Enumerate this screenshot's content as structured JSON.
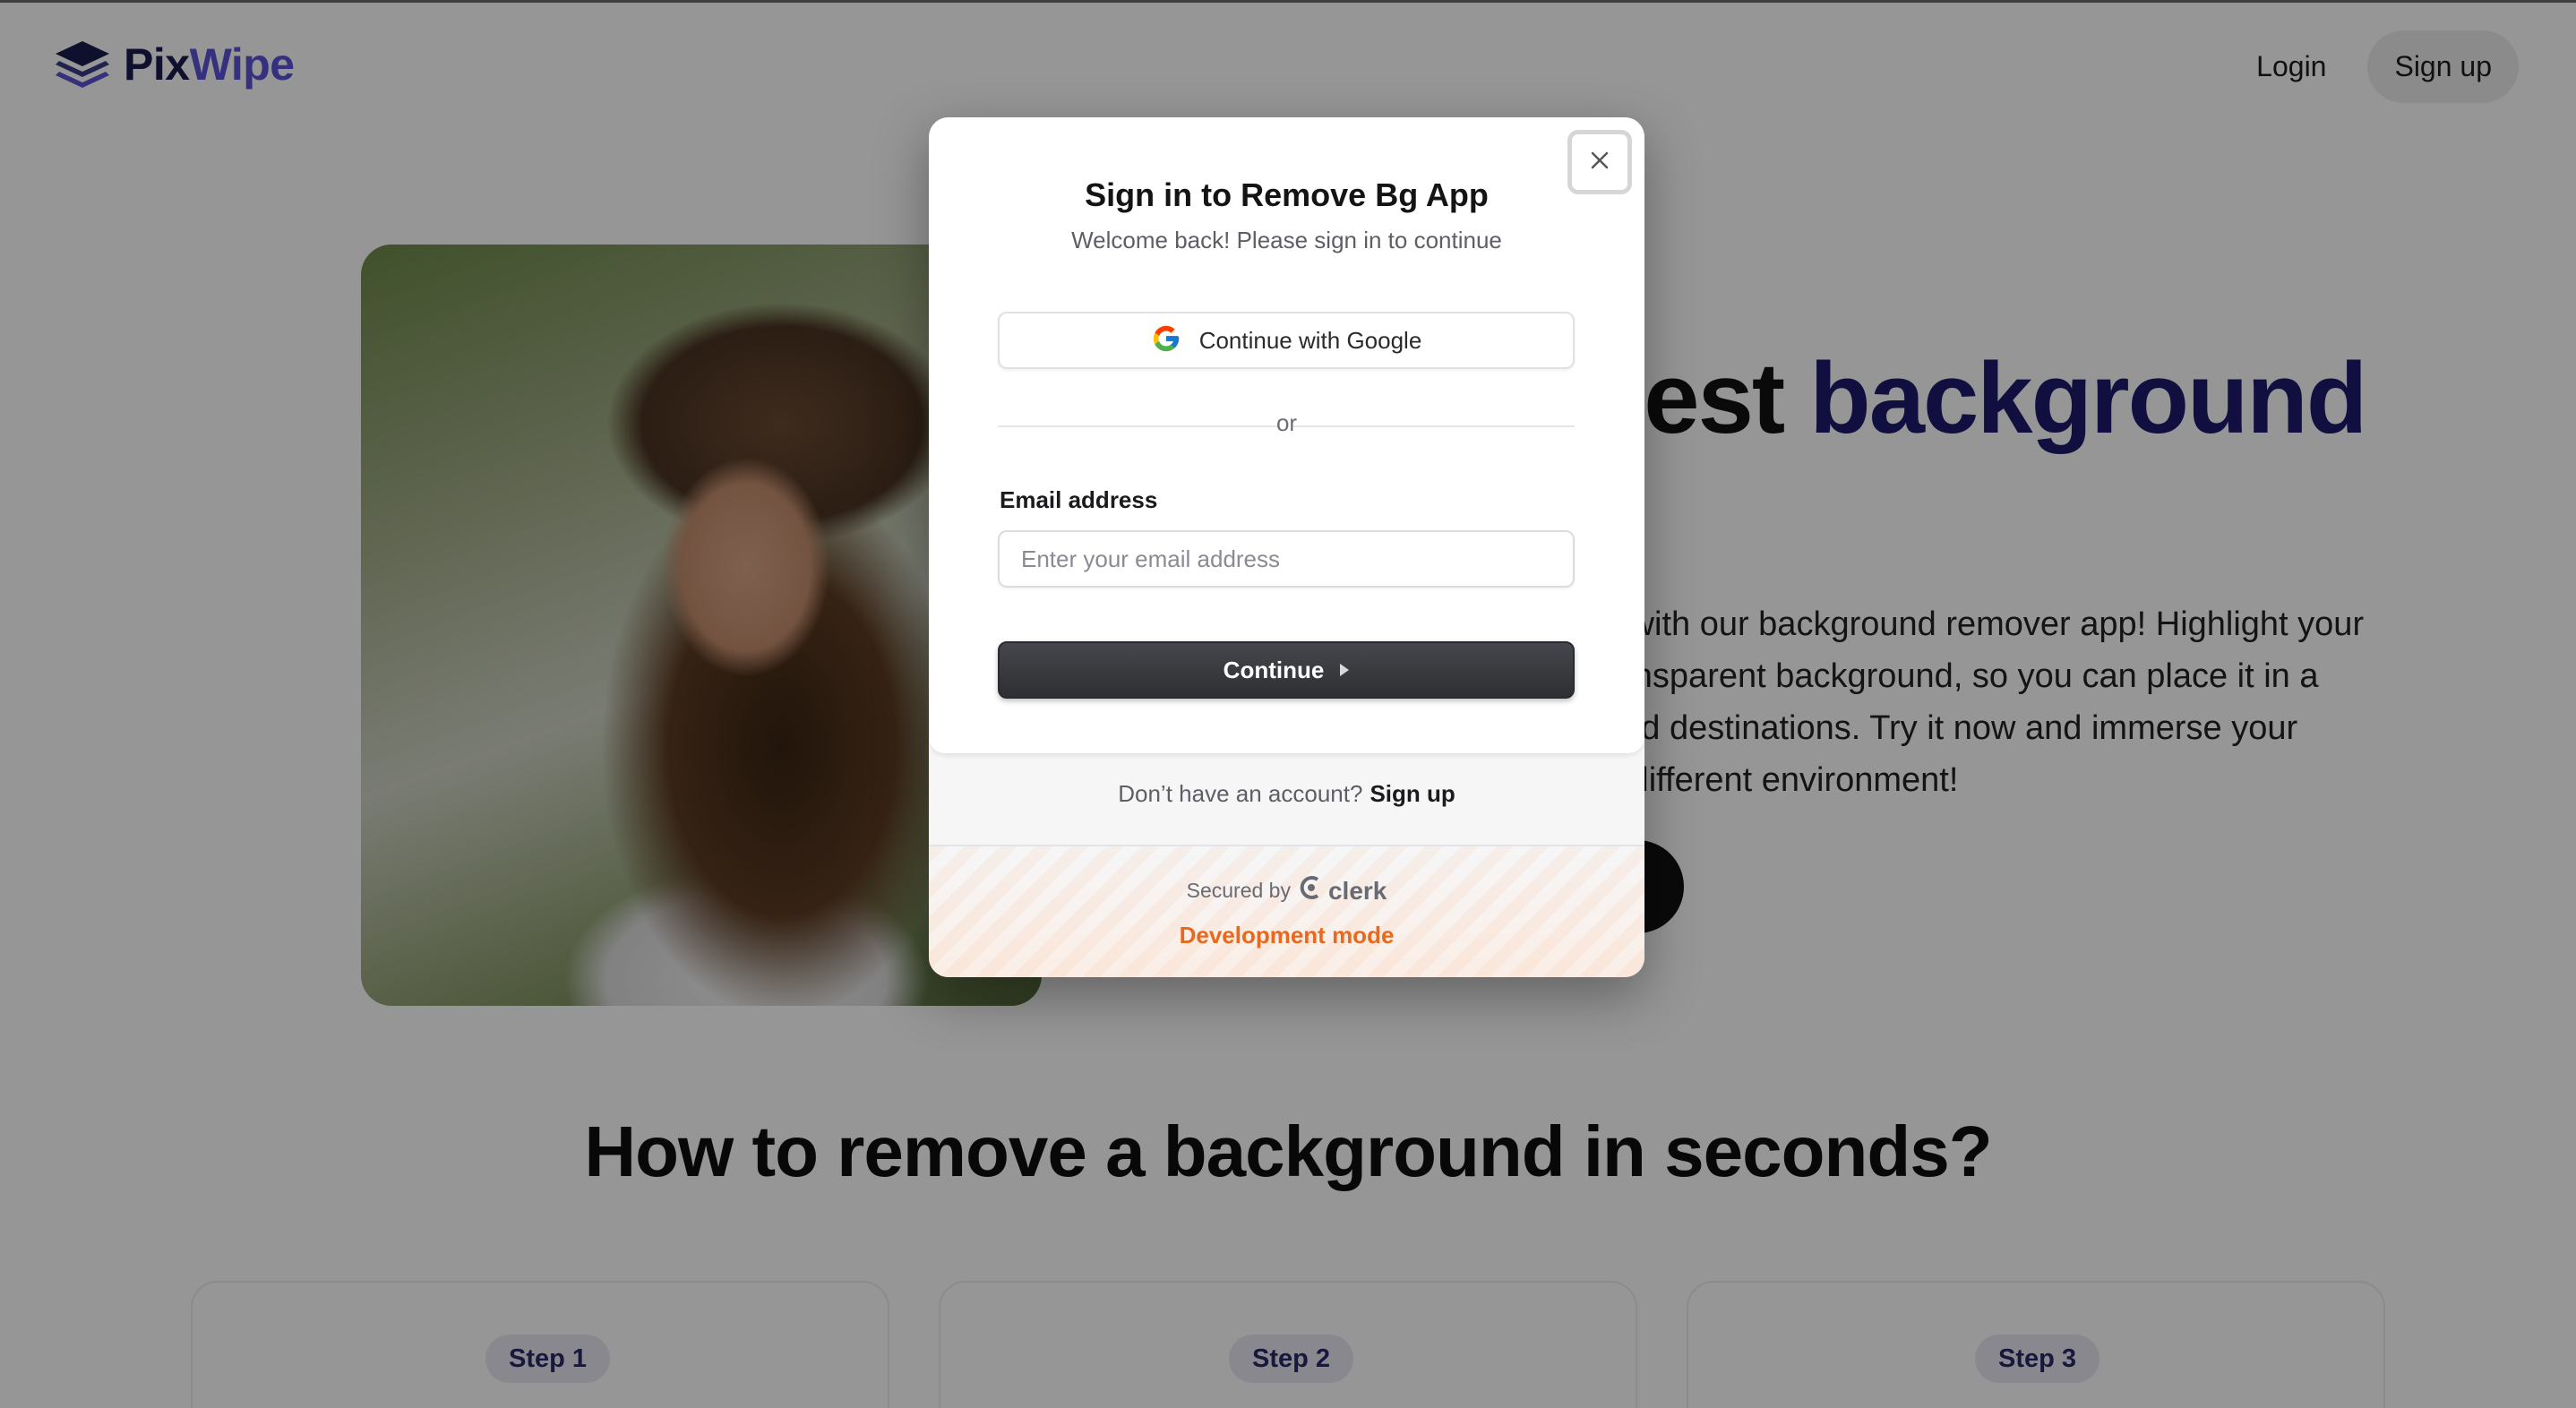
{
  "header": {
    "brand_first": "Pix",
    "brand_second": "Wipe",
    "login_label": "Login",
    "signup_label": "Sign up"
  },
  "hero": {
    "title_part1": "test ",
    "title_accent": "background",
    "paragraph_lines": [
      "s with our background remover app! Highlight your",
      "ransparent background, so you can place it in a",
      " and destinations. Try it now and immerse your",
      "y different environment!"
    ]
  },
  "section": {
    "title": "How to remove a background in seconds?",
    "steps": [
      "Step 1",
      "Step 2",
      "Step 3"
    ]
  },
  "modal": {
    "title": "Sign in to Remove Bg App",
    "subtitle": "Welcome back! Please sign in to continue",
    "google_button": "Continue with Google",
    "divider": "or",
    "email_label": "Email address",
    "email_placeholder": "Enter your email address",
    "email_value": "",
    "continue_button": "Continue",
    "no_account_text": "Don’t have an account?",
    "signup_link": "Sign up",
    "secured_by": "Secured by",
    "clerk_brand": "clerk",
    "dev_mode": "Development mode"
  },
  "icons": {
    "logo": "stacked-layers-icon",
    "close": "close-icon",
    "google": "google-icon",
    "continue_arrow": "caret-right-icon",
    "clerk": "clerk-logo-icon"
  },
  "colors": {
    "brand_dark": "#1a1a4e",
    "brand_light": "#5b54d6",
    "accent_title": "#1d1a6b",
    "button_dark": "#2e2f33",
    "dev_mode": "#e8691e"
  }
}
